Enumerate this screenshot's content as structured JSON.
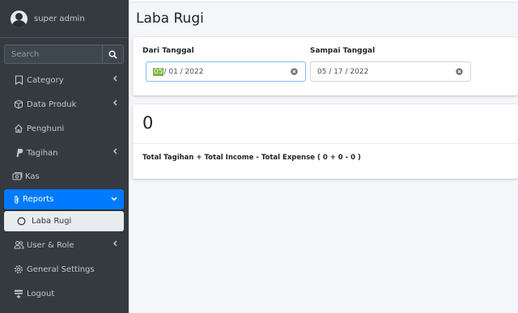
{
  "user": {
    "name": "super admin"
  },
  "search": {
    "placeholder": "Search"
  },
  "sidebar": {
    "items": [
      {
        "label": "Category"
      },
      {
        "label": "Data Produk"
      },
      {
        "label": "Penghuni"
      },
      {
        "label": "Tagihan"
      },
      {
        "label": "Kas"
      },
      {
        "label": "Reports"
      },
      {
        "label": "Laba Rugi"
      },
      {
        "label": "User & Role"
      },
      {
        "label": "General Settings"
      },
      {
        "label": "Logout"
      }
    ]
  },
  "page": {
    "title": "Laba Rugi"
  },
  "filters": {
    "from_label": "Dari Tanggal",
    "from_month": "05",
    "from_rest": "/ 01 / 2022",
    "to_label": "Sampai Tanggal",
    "to_value": "05 / 17 / 2022"
  },
  "result": {
    "value": "0",
    "formula": "Total Tagihan + Total Income - Total Expense ( 0 + 0 - 0 )"
  },
  "colors": {
    "sidebar_bg": "#343a40",
    "active": "#007bff",
    "date_highlight": "#7cb342"
  }
}
